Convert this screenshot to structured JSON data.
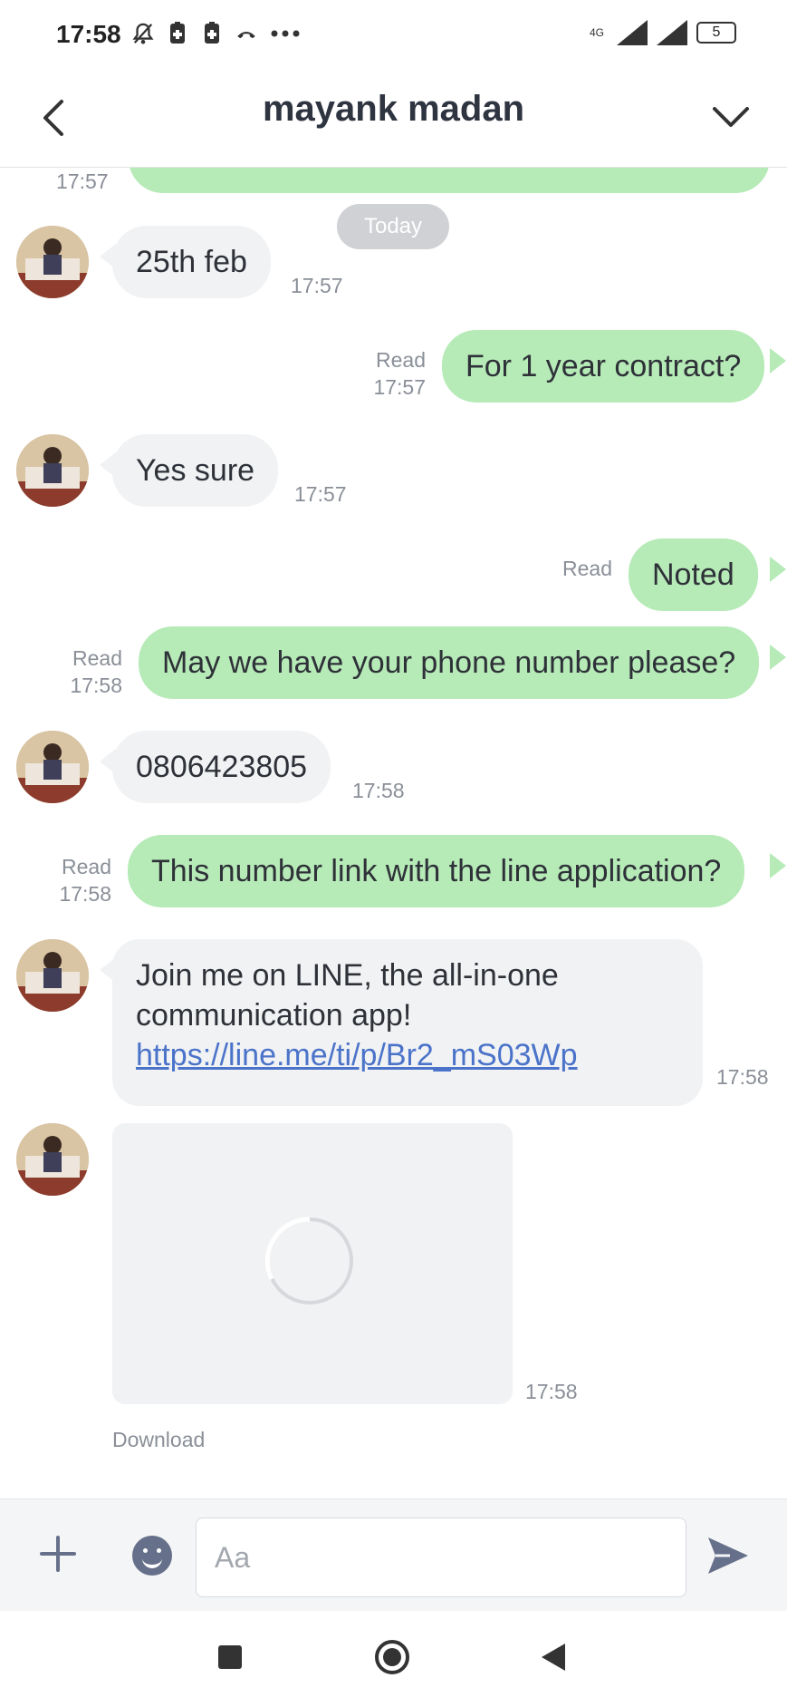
{
  "status_bar": {
    "time": "17:58",
    "network": "4G",
    "battery": "5",
    "icons": [
      "bell-off-icon",
      "sim-icon",
      "sim-icon",
      "missed-call-icon",
      "more-dots-icon"
    ]
  },
  "header": {
    "title": "mayank madan",
    "back_icon": "chevron-left-icon",
    "expand_icon": "chevron-down-icon"
  },
  "chat": {
    "cut_off_time": "17:57",
    "date_divider": "Today",
    "messages": [
      {
        "direction": "in",
        "text": "25th feb",
        "time": "17:57"
      },
      {
        "direction": "out",
        "text": "For 1 year contract?",
        "status": "Read",
        "time": "17:57"
      },
      {
        "direction": "in",
        "text": "Yes sure",
        "time": "17:57"
      },
      {
        "direction": "out",
        "text": "Noted",
        "status": "Read",
        "time": ""
      },
      {
        "direction": "out",
        "text": "May we have your phone number please?",
        "status": "Read",
        "time": "17:58"
      },
      {
        "direction": "in",
        "text": "0806423805",
        "time": "17:58"
      },
      {
        "direction": "out",
        "text": "This number link with the line application?",
        "status": "Read",
        "time": "17:58"
      },
      {
        "direction": "in",
        "text_line1": "Join me on LINE, the all-in-one",
        "text_line2": "communication app!",
        "link": "https://line.me/ti/p/Br2_mS03Wp",
        "time": "17:58"
      },
      {
        "direction": "in",
        "type": "image",
        "time": "17:58",
        "action": "Download"
      }
    ]
  },
  "input_bar": {
    "placeholder": "Aa",
    "value": "",
    "icons": [
      "plus-icon",
      "emoji-icon",
      "send-icon"
    ]
  },
  "colors": {
    "outgoing_bubble": "#b6eab7",
    "incoming_bubble": "#f1f2f4",
    "link": "#4a73c9",
    "icon_gray": "#66708a"
  }
}
